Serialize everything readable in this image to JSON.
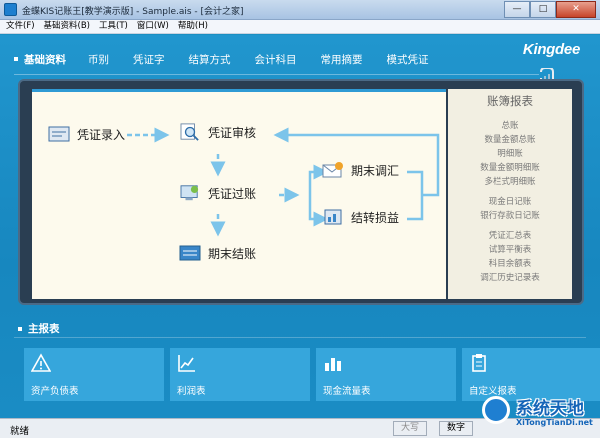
{
  "window": {
    "title": "金蝶KIS记账王[教学演示版] - Sample.ais - [会计之家]",
    "btn_min": "—",
    "btn_max": "□",
    "btn_close": "✕"
  },
  "menu": [
    "文件(F)",
    "基础资料(B)",
    "工具(T)",
    "窗口(W)",
    "帮助(H)"
  ],
  "nav": {
    "title": "基础资料",
    "items": [
      "币别",
      "凭证字",
      "结算方式",
      "会计科目",
      "常用摘要",
      "模式凭证"
    ]
  },
  "brand": "Kingdee",
  "flow": {
    "entry": "凭证录入",
    "review": "凭证审核",
    "post": "凭证过账",
    "adjust": "期末调汇",
    "pnl": "结转损益",
    "close": "期末结账"
  },
  "ledger": {
    "title": "账簿报表",
    "groups": [
      [
        "总账",
        "数量金额总账",
        "明细账",
        "数量金额明细账",
        "多栏式明细账"
      ],
      [
        "现金日记账",
        "银行存款日记账"
      ],
      [
        "凭证汇总表",
        "试算平衡表",
        "科目余额表",
        "调汇历史记录表"
      ]
    ]
  },
  "reports": {
    "title": "主报表",
    "tiles": [
      "资产负债表",
      "利润表",
      "现金流量表",
      "自定义报表"
    ]
  },
  "status": {
    "text": "就绪",
    "caps": "大写",
    "num": "数字"
  },
  "watermark": {
    "title": "系统天地",
    "url": "XiTongTianDi.net"
  },
  "colors": {
    "background": "#1a8fc2",
    "board": "#2a3e52",
    "board_paper": "#fdfaed",
    "tile": "#36a6dc",
    "arrow": "#7cc4ea"
  }
}
